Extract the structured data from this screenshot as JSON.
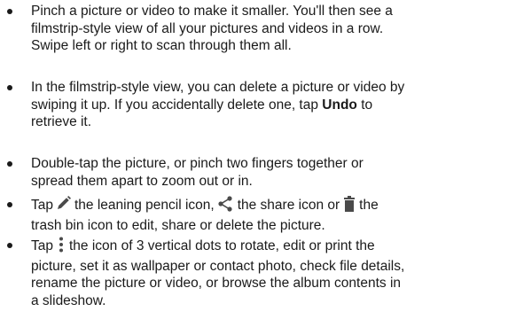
{
  "items": [
    {
      "lines": [
        "Pinch a picture or video to make it smaller. You'll then see a",
        "filmstrip-style view of all your pictures and videos in a row.",
        "Swipe left or right to scan through them all."
      ]
    },
    {
      "line1": "In the filmstrip-style view, you can delete a picture or video by",
      "line2": "swiping it up. If you accidentally delete one, tap ",
      "undo_label": "Undo",
      "line2_tail": " to",
      "line3": "retrieve it."
    },
    {
      "lines": [
        "Double-tap the picture, or pinch two fingers together or",
        "spread them apart to zoom out or in."
      ]
    },
    {
      "l1_a": "Tap",
      "pencil_icon": "pencil-icon",
      "l1_b": "the leaning pencil icon,",
      "share_icon": "share-icon",
      "l1_c": "the share icon or",
      "trash_icon": "trash-icon",
      "l1_d": "the",
      "line2": "trash bin icon to edit, share or delete the picture."
    },
    {
      "l1_a": "Tap",
      "dots_icon": "vertical-dots-icon",
      "l1_b": "the icon of 3 vertical dots to rotate, edit or print the",
      "lines": [
        "picture, set it as wallpaper or contact photo, check file details,",
        "rename the picture or video, or browse the album contents in",
        "a slideshow."
      ]
    }
  ]
}
